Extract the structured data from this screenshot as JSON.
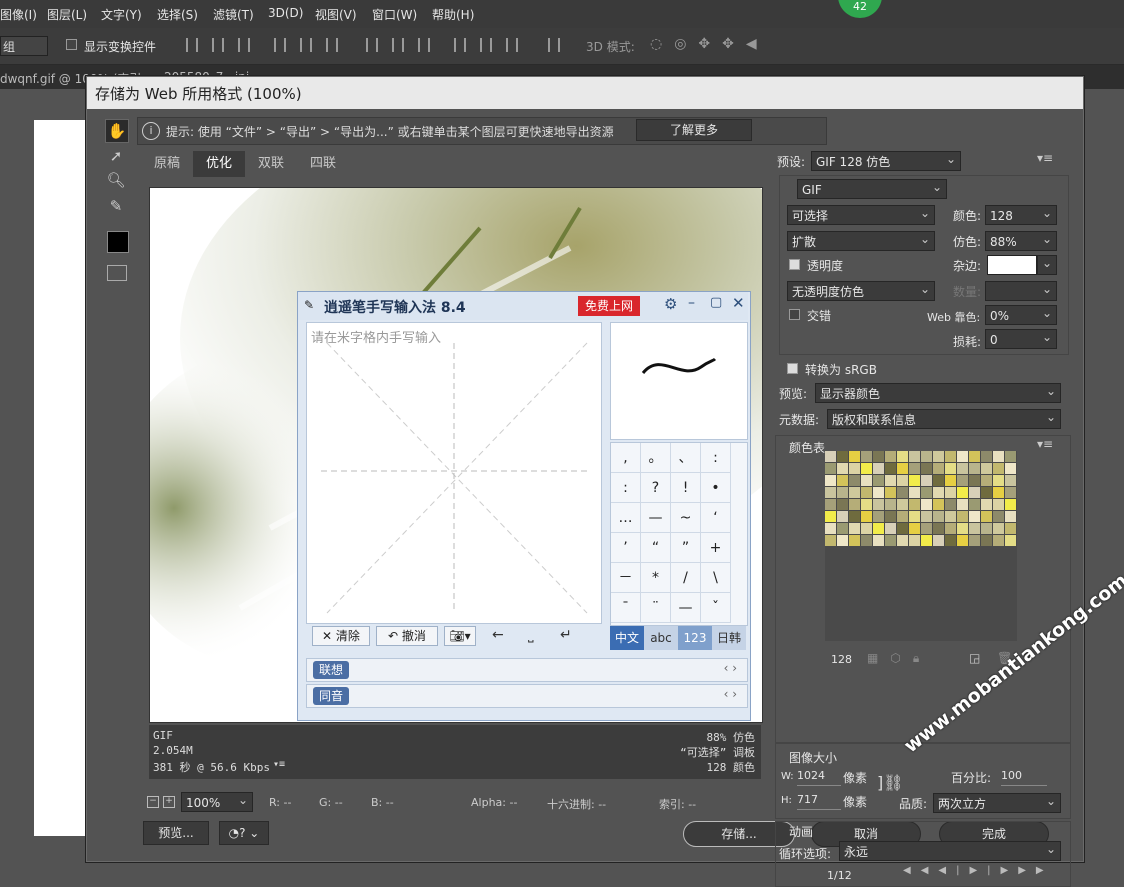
{
  "menubar": {
    "items": [
      "图像(I)",
      "图层(L)",
      "文字(Y)",
      "选择(S)",
      "滤镜(T)",
      "3D(D)",
      "视图(V)",
      "窗口(W)",
      "帮助(H)"
    ],
    "badge": "42"
  },
  "options_bar": {
    "group_select": "组",
    "show_transform": "显示变换控件",
    "mode_3d": "3D 模式:"
  },
  "doc_tabs": [
    "dwqnf.gif @ 100% (索引...",
    "205580_7...jpi..."
  ],
  "dialog": {
    "title": "存储为 Web 所用格式 (100%)",
    "hint": "提示: 使用 “文件” > “导出” > “导出为...” 或右键单击某个图层可更快速地导出资源",
    "learn_more": "了解更多",
    "tabs": [
      "原稿",
      "优化",
      "双联",
      "四联"
    ],
    "info": {
      "format": "GIF",
      "size": "2.054M",
      "time": "381 秒 @ 56.6 Kbps",
      "dither": "88% 仿色",
      "palette": "“可选择” 调板",
      "colors": "128 颜色"
    },
    "bottom": {
      "zoom": "100%",
      "r": "R: --",
      "g": "G: --",
      "b": "B: --",
      "alpha": "Alpha: --",
      "hex": "十六进制: --",
      "index": "索引: --"
    },
    "buttons": {
      "preview": "预览...",
      "save": "存储...",
      "cancel": "取消",
      "done": "完成"
    }
  },
  "ime": {
    "title": "逍遥笔手写输入法 8.4",
    "free": "免费上网",
    "placeholder": "请在米字格内手写输入",
    "clear": "清除",
    "undo": "撤消",
    "symbols": [
      [
        ",",
        "。",
        "、",
        ":"
      ],
      [
        ":",
        "?",
        "!",
        "•"
      ],
      [
        "…",
        "—",
        "~",
        "‘"
      ],
      [
        "’",
        "“",
        "”",
        "+"
      ],
      [
        "－",
        "*",
        "/",
        "\\"
      ],
      [
        "ˉ",
        "¨",
        "—",
        "ˇ"
      ]
    ],
    "modes": [
      "中文",
      "abc",
      "123",
      "日韩"
    ],
    "rows": [
      "联想",
      "同音"
    ]
  },
  "right": {
    "preset_label": "预设:",
    "preset": "GIF 128 仿色",
    "format": "GIF",
    "reduction": "可选择",
    "dither_algo": "扩散",
    "transparency": "透明度",
    "matte_dither": "无透明度仿色",
    "interlace": "交错",
    "colors_label": "颜色:",
    "colors": "128",
    "dither_label": "仿色:",
    "dither": "88%",
    "matte_label": "杂边:",
    "amount_label": "数量:",
    "web_snap_label": "Web 靠色:",
    "web_snap": "0%",
    "lossy_label": "损耗:",
    "lossy": "0",
    "convert_srgb": "转换为 sRGB",
    "preview_label": "预览:",
    "preview": "显示器颜色",
    "metadata_label": "元数据:",
    "metadata": "版权和联系信息",
    "color_table": "颜色表",
    "color_count": "128",
    "image_size": "图像大小",
    "w_label": "W:",
    "w": "1024",
    "h_label": "H:",
    "h": "717",
    "px": "像素",
    "percent_label": "百分比:",
    "percent": "100",
    "quality_label": "品质:",
    "quality": "两次立方",
    "animation": "动画",
    "loop_label": "循环选项:",
    "loop": "永远",
    "frame": "1/12"
  },
  "watermark": "www.mobantiankong.com",
  "colors": {
    "accent_green": "#2fa84f",
    "ime_red": "#d9262c"
  }
}
